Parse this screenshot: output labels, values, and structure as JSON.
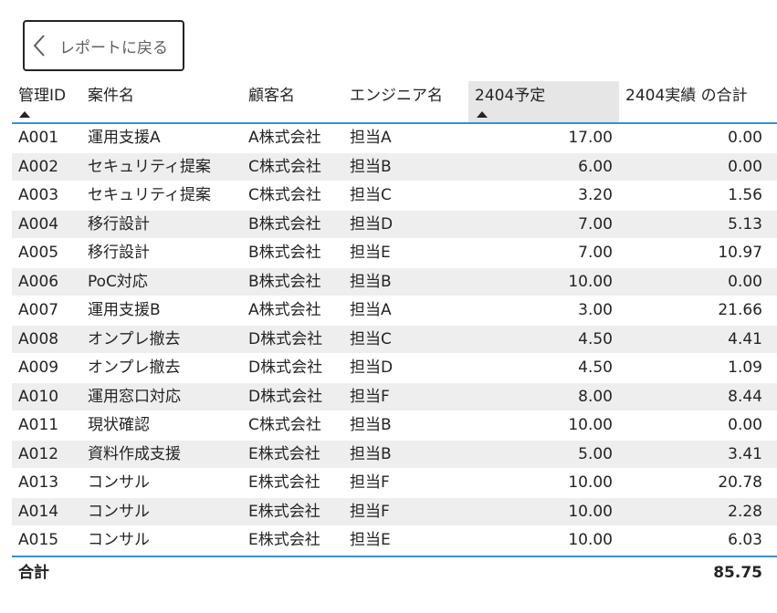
{
  "back_button": {
    "label": "レポートに戻る",
    "icon": "chevron-left-icon"
  },
  "table": {
    "columns": [
      {
        "key": "id",
        "label": "管理ID",
        "sorted": "asc"
      },
      {
        "key": "case",
        "label": "案件名"
      },
      {
        "key": "customer",
        "label": "顧客名"
      },
      {
        "key": "engineer",
        "label": "エンジニア名"
      },
      {
        "key": "plan",
        "label": "2404予定",
        "sorted": "asc",
        "highlighted": true
      },
      {
        "key": "actual",
        "label": "2404実績 の合計"
      }
    ],
    "rows": [
      {
        "id": "A001",
        "case": "運用支援A",
        "customer": "A株式会社",
        "engineer": "担当A",
        "plan": "17.00",
        "actual": "0.00"
      },
      {
        "id": "A002",
        "case": "セキュリティ提案",
        "customer": "C株式会社",
        "engineer": "担当B",
        "plan": "6.00",
        "actual": "0.00"
      },
      {
        "id": "A003",
        "case": "セキュリティ提案",
        "customer": "C株式会社",
        "engineer": "担当C",
        "plan": "3.20",
        "actual": "1.56"
      },
      {
        "id": "A004",
        "case": "移行設計",
        "customer": "B株式会社",
        "engineer": "担当D",
        "plan": "7.00",
        "actual": "5.13"
      },
      {
        "id": "A005",
        "case": "移行設計",
        "customer": "B株式会社",
        "engineer": "担当E",
        "plan": "7.00",
        "actual": "10.97"
      },
      {
        "id": "A006",
        "case": "PoC対応",
        "customer": "B株式会社",
        "engineer": "担当B",
        "plan": "10.00",
        "actual": "0.00"
      },
      {
        "id": "A007",
        "case": "運用支援B",
        "customer": "A株式会社",
        "engineer": "担当A",
        "plan": "3.00",
        "actual": "21.66"
      },
      {
        "id": "A008",
        "case": "オンプレ撤去",
        "customer": "D株式会社",
        "engineer": "担当C",
        "plan": "4.50",
        "actual": "4.41"
      },
      {
        "id": "A009",
        "case": "オンプレ撤去",
        "customer": "D株式会社",
        "engineer": "担当D",
        "plan": "4.50",
        "actual": "1.09"
      },
      {
        "id": "A010",
        "case": "運用窓口対応",
        "customer": "D株式会社",
        "engineer": "担当F",
        "plan": "8.00",
        "actual": "8.44"
      },
      {
        "id": "A011",
        "case": "現状確認",
        "customer": "C株式会社",
        "engineer": "担当B",
        "plan": "10.00",
        "actual": "0.00"
      },
      {
        "id": "A012",
        "case": "資料作成支援",
        "customer": "E株式会社",
        "engineer": "担当B",
        "plan": "5.00",
        "actual": "3.41"
      },
      {
        "id": "A013",
        "case": "コンサル",
        "customer": "E株式会社",
        "engineer": "担当F",
        "plan": "10.00",
        "actual": "20.78"
      },
      {
        "id": "A014",
        "case": "コンサル",
        "customer": "E株式会社",
        "engineer": "担当F",
        "plan": "10.00",
        "actual": "2.28"
      },
      {
        "id": "A015",
        "case": "コンサル",
        "customer": "E株式会社",
        "engineer": "担当E",
        "plan": "10.00",
        "actual": "6.03"
      }
    ],
    "total": {
      "label": "合計",
      "actual": "85.75"
    }
  },
  "colors": {
    "accent_line": "#3a8fd6",
    "alt_row": "#eeeeee",
    "highlight_header": "#e6e6e6"
  }
}
